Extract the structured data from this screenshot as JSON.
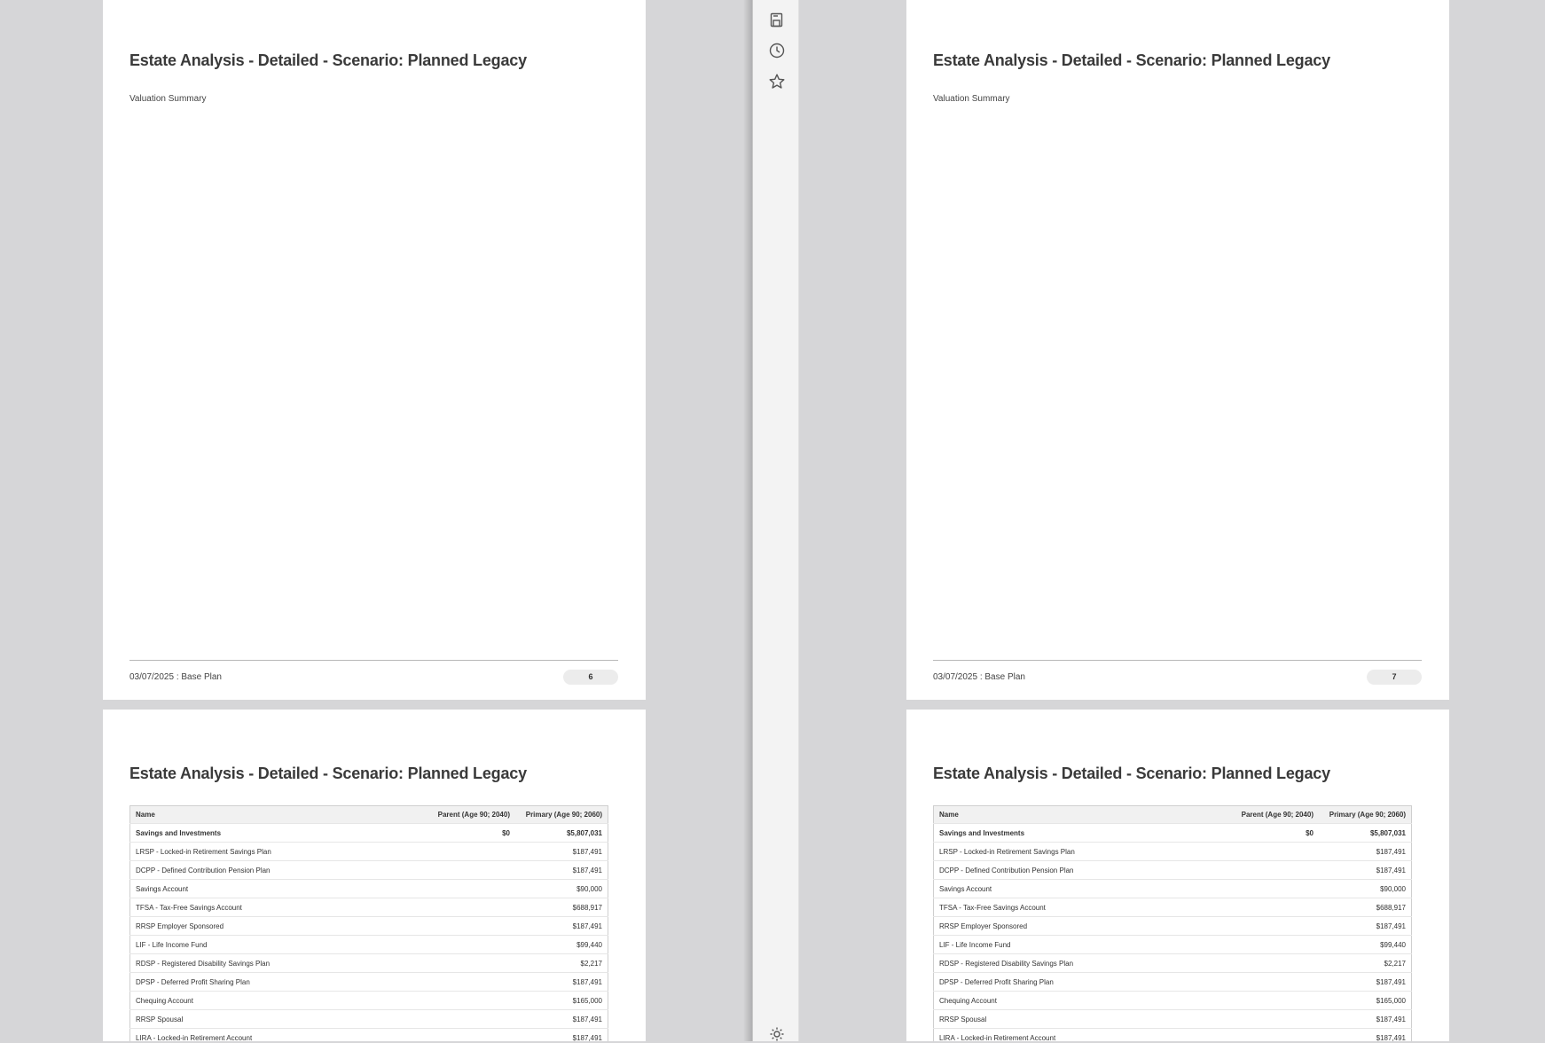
{
  "report": {
    "title": "Estate Analysis - Detailed - Scenario: Planned Legacy",
    "subtitle": "Valuation Summary",
    "footer": "03/07/2025 : Base Plan"
  },
  "pages": {
    "left_top_number": "6",
    "right_top_number": "7"
  },
  "table": {
    "headers": [
      "Name",
      "Parent (Age 90; 2040)",
      "Primary (Age 90; 2060)"
    ],
    "rows": [
      {
        "name": "Savings and Investments",
        "parent": "$0",
        "primary": "$5,807,031"
      },
      {
        "name": "LRSP - Locked-in Retirement Savings Plan",
        "parent": "",
        "primary": "$187,491"
      },
      {
        "name": "DCPP - Defined Contribution Pension Plan",
        "parent": "",
        "primary": "$187,491"
      },
      {
        "name": "Savings Account",
        "parent": "",
        "primary": "$90,000"
      },
      {
        "name": "TFSA - Tax-Free Savings Account",
        "parent": "",
        "primary": "$688,917"
      },
      {
        "name": "RRSP Employer Sponsored",
        "parent": "",
        "primary": "$187,491"
      },
      {
        "name": "LIF - Life Income Fund",
        "parent": "",
        "primary": "$99,440"
      },
      {
        "name": "RDSP - Registered Disability Savings Plan",
        "parent": "",
        "primary": "$2,217"
      },
      {
        "name": "DPSP - Deferred Profit Sharing Plan",
        "parent": "",
        "primary": "$187,491"
      },
      {
        "name": "Chequing Account",
        "parent": "",
        "primary": "$165,000"
      },
      {
        "name": "RRSP Spousal",
        "parent": "",
        "primary": "$187,491"
      },
      {
        "name": "LIRA - Locked-in Retirement Account",
        "parent": "",
        "primary": "$187,491"
      }
    ]
  },
  "sidebar": {
    "icons": [
      "save-page-icon",
      "history-icon",
      "favorites-star-icon",
      "settings-gear-icon"
    ]
  }
}
